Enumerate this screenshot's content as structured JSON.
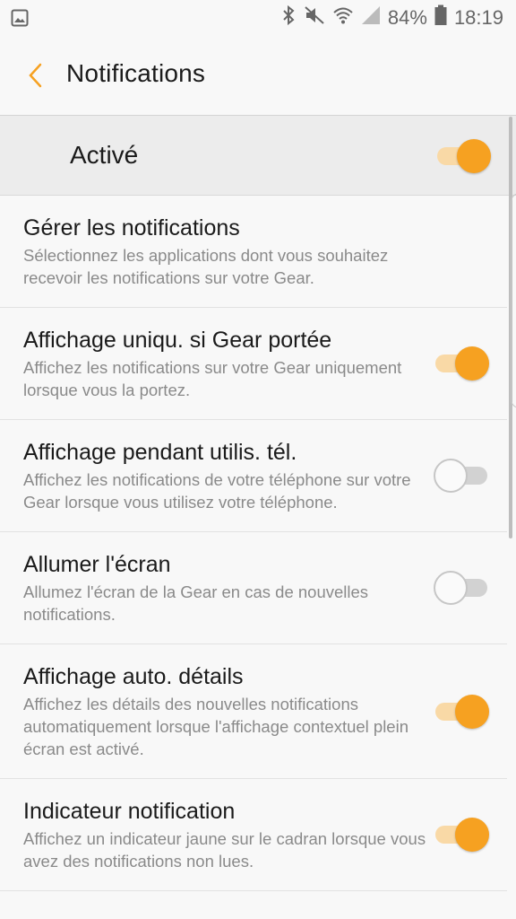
{
  "status_bar": {
    "battery_percent": "84%",
    "time": "18:19",
    "icons": [
      "gallery-icon",
      "bluetooth-icon",
      "mute-icon",
      "wifi-icon",
      "signal-icon",
      "battery-icon"
    ]
  },
  "header": {
    "title": "Notifications"
  },
  "master_switch": {
    "label": "Activé",
    "enabled": true
  },
  "colors": {
    "accent": "#f6a121",
    "track_on": "#f9d9a6",
    "track_off": "#d2d2d2"
  },
  "settings": [
    {
      "title": "Gérer les notifications",
      "description": "Sélectionnez les applications dont vous souhaitez recevoir les notifications sur votre Gear.",
      "has_toggle": false
    },
    {
      "title": "Affichage uniqu. si Gear portée",
      "description": "Affichez les notifications sur votre Gear uniquement lorsque vous la portez.",
      "has_toggle": true,
      "enabled": true
    },
    {
      "title": "Affichage pendant utilis. tél.",
      "description": "Affichez les notifications de votre téléphone sur votre Gear lorsque vous utilisez votre téléphone.",
      "has_toggle": true,
      "enabled": false
    },
    {
      "title": "Allumer l'écran",
      "description": "Allumez l'écran de la Gear en cas de nouvelles notifications.",
      "has_toggle": true,
      "enabled": false
    },
    {
      "title": "Affichage auto. détails",
      "description": "Affichez les détails des nouvelles notifications automatiquement lorsque l'affichage contextuel plein écran est activé.",
      "has_toggle": true,
      "enabled": true
    },
    {
      "title": "Indicateur notification",
      "description": "Affichez un indicateur jaune sur le cadran lorsque vous avez des notifications non lues.",
      "has_toggle": true,
      "enabled": true
    }
  ]
}
